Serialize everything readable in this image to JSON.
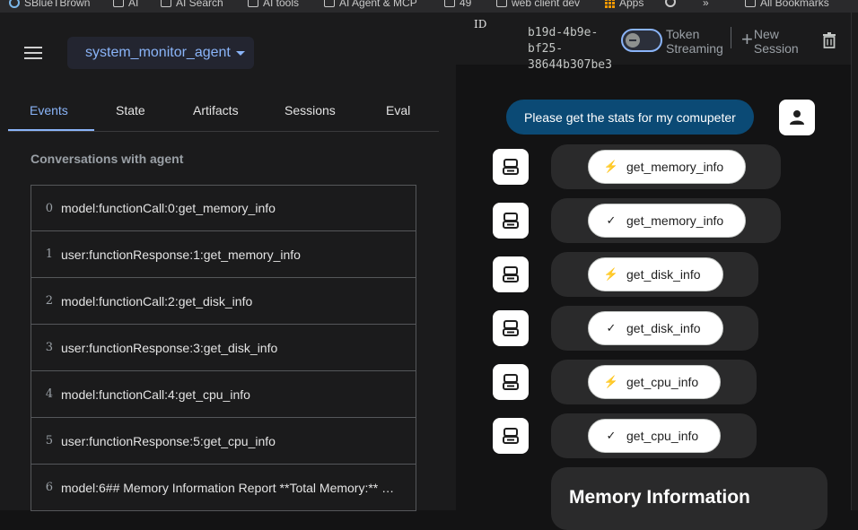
{
  "bookmarks": [
    {
      "label": "SBlueTBrown",
      "icon": "profile-icon"
    },
    {
      "label": "AI",
      "icon": "folder-icon"
    },
    {
      "label": "AI Search",
      "icon": "folder-icon"
    },
    {
      "label": "AI tools",
      "icon": "folder-icon"
    },
    {
      "label": "AI Agent & MCP",
      "icon": "folder-icon"
    },
    {
      "label": "49",
      "icon": "folder-icon"
    },
    {
      "label": "web client dev",
      "icon": "folder-icon"
    },
    {
      "label": "Apps",
      "icon": "apps-grid-icon"
    },
    {
      "label": "»",
      "icon": "overflow-icon"
    },
    {
      "label": "All Bookmarks",
      "icon": "folder-icon"
    }
  ],
  "header": {
    "agent_name": "system_monitor_agent"
  },
  "tabs": [
    {
      "label": "Events",
      "active": true
    },
    {
      "label": "State",
      "active": false
    },
    {
      "label": "Artifacts",
      "active": false
    },
    {
      "label": "Sessions",
      "active": false
    },
    {
      "label": "Eval",
      "active": false
    }
  ],
  "conversation": {
    "title": "Conversations with agent",
    "events": [
      {
        "index": "0",
        "text": "model:functionCall:0:get_memory_info"
      },
      {
        "index": "1",
        "text": "user:functionResponse:1:get_memory_info"
      },
      {
        "index": "2",
        "text": "model:functionCall:2:get_disk_info"
      },
      {
        "index": "3",
        "text": "user:functionResponse:3:get_disk_info"
      },
      {
        "index": "4",
        "text": "model:functionCall:4:get_cpu_info"
      },
      {
        "index": "5",
        "text": "user:functionResponse:5:get_cpu_info"
      },
      {
        "index": "6",
        "text": "model:6## Memory Information Report **Total Memory:** …"
      }
    ]
  },
  "session": {
    "id_label": "ID",
    "id_lines": [
      "b19d-4b9e-",
      "bf25-",
      "38644b307be3"
    ],
    "token_label_1": "Token",
    "token_label_2": "Streaming",
    "token_streaming_on": false,
    "new_label_1": "New",
    "new_label_2": "Session"
  },
  "chat": {
    "user_message": "Please get the stats for my comupeter",
    "function_chips": [
      {
        "label": "get_memory_info",
        "kind": "call",
        "icon": "bolt-icon"
      },
      {
        "label": "get_memory_info",
        "kind": "response",
        "icon": "check-icon"
      },
      {
        "label": "get_disk_info",
        "kind": "call",
        "icon": "bolt-icon"
      },
      {
        "label": "get_disk_info",
        "kind": "response",
        "icon": "check-icon"
      },
      {
        "label": "get_cpu_info",
        "kind": "call",
        "icon": "bolt-icon"
      },
      {
        "label": "get_cpu_info",
        "kind": "response",
        "icon": "check-icon"
      }
    ],
    "report_heading": "Memory Information"
  },
  "colors": {
    "accent": "#8ab4f8",
    "user_bubble": "#0b4a75",
    "background": "#131314",
    "panel": "#1b1b1c"
  }
}
